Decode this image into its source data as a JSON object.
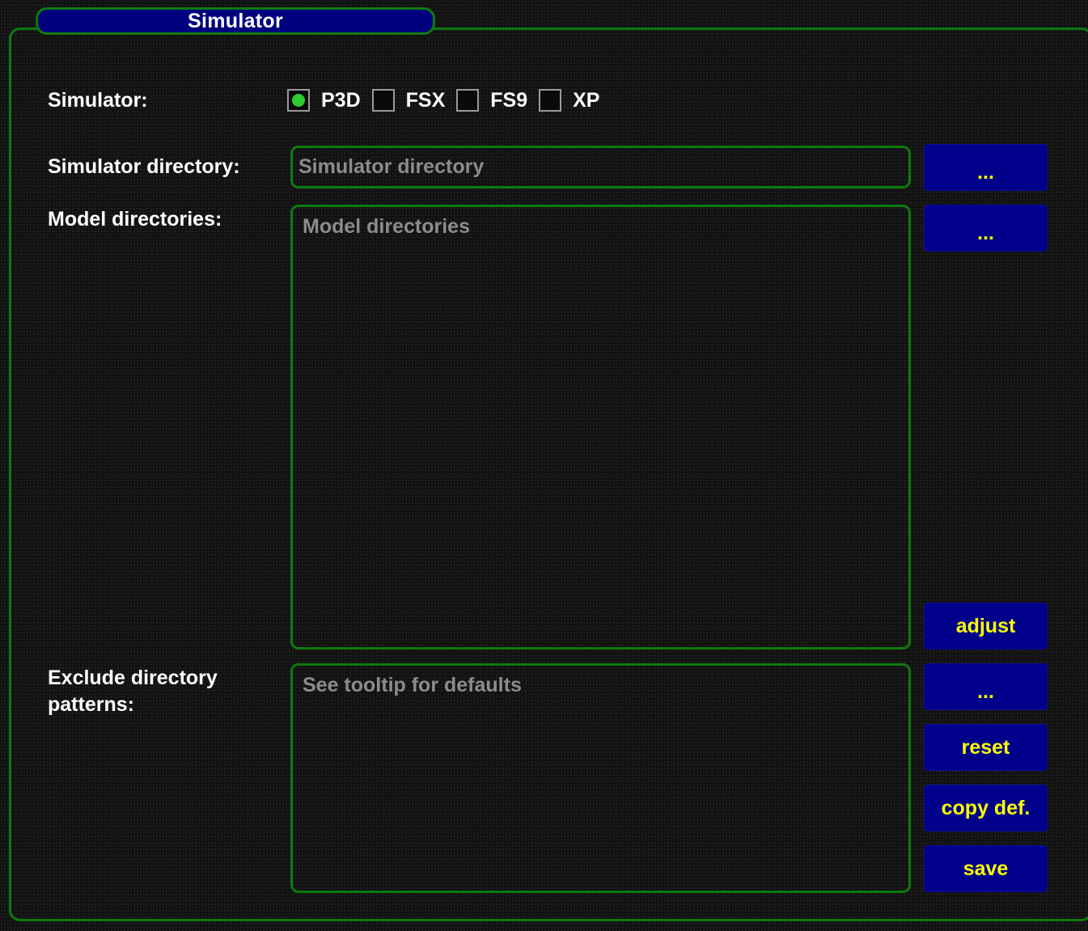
{
  "panel": {
    "title": "Simulator"
  },
  "simulator": {
    "label": "Simulator:",
    "options": [
      {
        "label": "P3D",
        "checked": true
      },
      {
        "label": "FSX",
        "checked": false
      },
      {
        "label": "FS9",
        "checked": false
      },
      {
        "label": "XP",
        "checked": false
      }
    ]
  },
  "simulator_directory": {
    "label": "Simulator directory:",
    "value": "",
    "placeholder": "Simulator directory",
    "browse_label": "..."
  },
  "model_directories": {
    "label": "Model directories:",
    "value": "",
    "placeholder": "Model directories",
    "browse_label": "...",
    "adjust_label": "adjust"
  },
  "exclude_patterns": {
    "label_line1": "Exclude directory",
    "label_line2": "patterns:",
    "value": "",
    "placeholder": "See tooltip for defaults",
    "browse_label": "...",
    "reset_label": "reset",
    "copy_def_label": "copy def.",
    "save_label": "save"
  },
  "colors": {
    "border": "#0d7a0d",
    "button_bg": "#00008a",
    "button_text": "#ffff00",
    "radio_checked": "#2ecc2e"
  }
}
